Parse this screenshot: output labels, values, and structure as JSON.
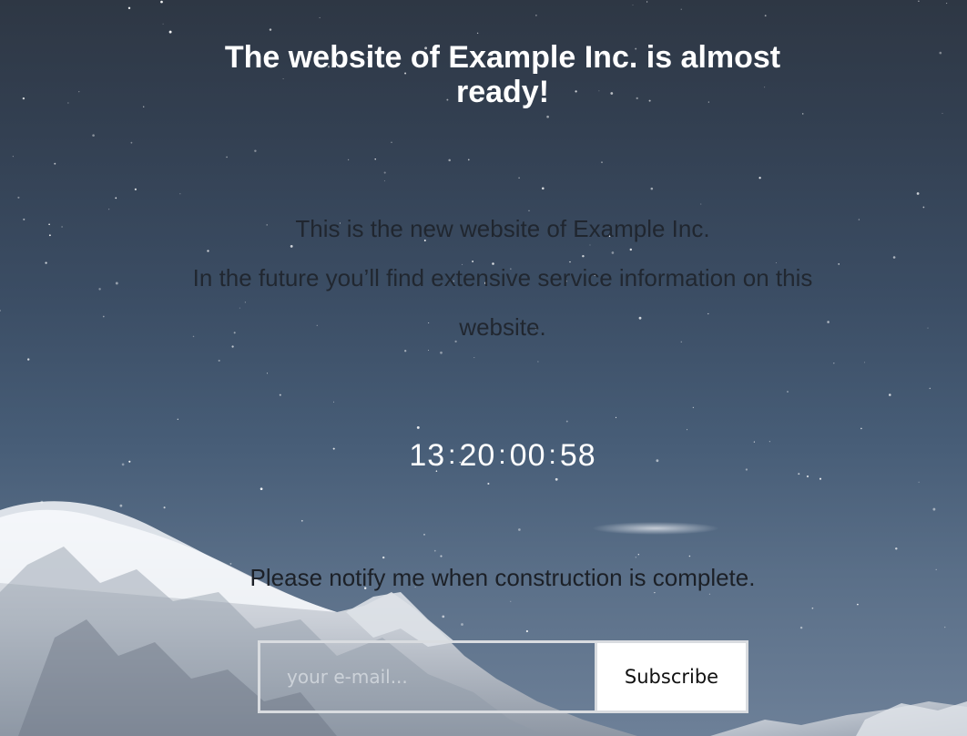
{
  "page": {
    "headline": "The website of Example Inc. is almost ready!",
    "intro_line1": "This is the new website of Example Inc.",
    "intro_line2": "In the future you’ll find extensive service information on this website."
  },
  "countdown": {
    "days": "13",
    "hours": "20",
    "minutes": "00",
    "seconds": "58",
    "separator": ":"
  },
  "notify": {
    "text": "Please notify me when construction is complete.",
    "email_placeholder": "your e-mail...",
    "email_value": "",
    "subscribe_label": "Subscribe"
  },
  "colors": {
    "headline": "#ffffff",
    "body_text": "#1f242c",
    "button_bg": "#ffffff",
    "button_border": "#d9dce0"
  }
}
